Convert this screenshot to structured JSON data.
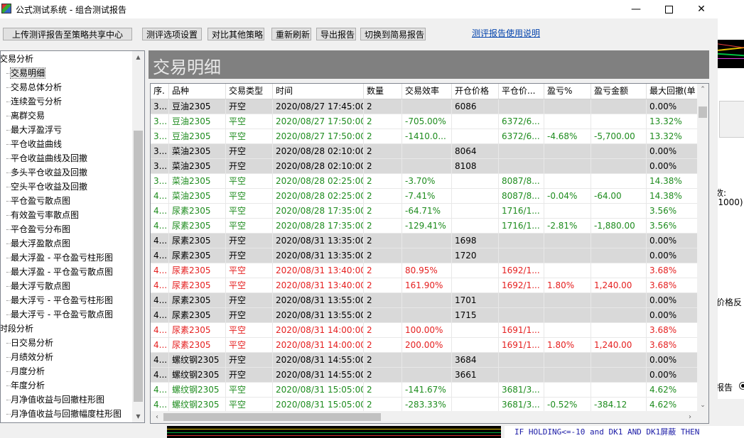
{
  "window": {
    "title": "公式测试系统 - 组合测试报告"
  },
  "toolbar": {
    "upload_label": "上传测评报告至策略共享中心",
    "options_label": "测评选项设置",
    "compare_label": "对比其他策略",
    "refresh_label": "重新刷新",
    "export_label": "导出报告",
    "switch_label": "切换到简易报告",
    "help_link": "测评报告使用说明"
  },
  "tree": {
    "groups": [
      {
        "label": "交易分析",
        "items": [
          "交易明细",
          "交易总体分析",
          "连续盈亏分析",
          "离群交易",
          "最大浮盈浮亏",
          "平仓收益曲线",
          "平仓收益曲线及回撤",
          "多头平仓收益及回撤",
          "空头平仓收益及回撤",
          "平仓盈亏散点图",
          "有效盈亏率散点图",
          "平仓盈亏分布图",
          "最大浮盈散点图",
          "最大浮盈 - 平仓盈亏柱形图",
          "最大浮盈 - 平仓盈亏散点图",
          "最大浮亏散点图",
          "最大浮亏 - 平仓盈亏柱形图",
          "最大浮亏 - 平仓盈亏散点图"
        ]
      },
      {
        "label": "时段分析",
        "items": [
          "日交易分析",
          "月绩效分析",
          "月度分析",
          "年度分析",
          "月净值收益与回撤柱形图",
          "月净值收益与回撤幅度柱形图"
        ]
      }
    ],
    "selected": "交易明细"
  },
  "main": {
    "title": "交易明细",
    "columns": [
      "序.",
      "品种",
      "交易类型",
      "时间",
      "数量",
      "交易效率",
      "开仓价格",
      "平仓价...",
      "盈亏%",
      "盈亏金额",
      "最大回撤(单"
    ],
    "rows": [
      {
        "style": "gray",
        "color": "black",
        "cells": [
          "3...",
          "豆油2305",
          "开空",
          "2020/08/27 17:45:00",
          "2",
          "",
          "6086",
          "",
          "",
          "",
          "0.00%"
        ]
      },
      {
        "style": "white",
        "color": "green",
        "cells": [
          "3...",
          "豆油2305",
          "平空",
          "2020/08/27 17:50:00",
          "2",
          "-705.00%",
          "",
          "6372/6...",
          "",
          "",
          "13.32%"
        ]
      },
      {
        "style": "white",
        "color": "green",
        "cells": [
          "3...",
          "豆油2305",
          "平空",
          "2020/08/27 17:50:00",
          "2",
          "-1410.0...",
          "",
          "6372/6...",
          "-4.68%",
          "-5,700.00",
          "13.32%"
        ]
      },
      {
        "style": "gray",
        "color": "black",
        "cells": [
          "3...",
          "菜油2305",
          "开空",
          "2020/08/28 02:10:00",
          "2",
          "",
          "8064",
          "",
          "",
          "",
          "0.00%"
        ]
      },
      {
        "style": "gray",
        "color": "black",
        "cells": [
          "3...",
          "菜油2305",
          "开空",
          "2020/08/28 02:10:00",
          "2",
          "",
          "8108",
          "",
          "",
          "",
          "0.00%"
        ]
      },
      {
        "style": "white",
        "color": "green",
        "cells": [
          "3...",
          "菜油2305",
          "平空",
          "2020/08/28 02:25:00",
          "2",
          "-3.70%",
          "",
          "8087/8...",
          "",
          "",
          "14.38%"
        ]
      },
      {
        "style": "white",
        "color": "green",
        "cells": [
          "4...",
          "菜油2305",
          "平空",
          "2020/08/28 02:25:00",
          "2",
          "-7.41%",
          "",
          "8087/8...",
          "-0.04%",
          "-64.00",
          "14.38%"
        ]
      },
      {
        "style": "white",
        "color": "green",
        "cells": [
          "4...",
          "尿素2305",
          "平空",
          "2020/08/28 17:35:00",
          "2",
          "-64.71%",
          "",
          "1716/1...",
          "",
          "",
          "3.56%"
        ]
      },
      {
        "style": "white",
        "color": "green",
        "cells": [
          "4...",
          "尿素2305",
          "平空",
          "2020/08/28 17:35:00",
          "2",
          "-129.41%",
          "",
          "1716/1...",
          "-2.81%",
          "-1,880.00",
          "3.56%"
        ]
      },
      {
        "style": "gray",
        "color": "black",
        "cells": [
          "4...",
          "尿素2305",
          "开空",
          "2020/08/31 13:35:00",
          "2",
          "",
          "1698",
          "",
          "",
          "",
          "0.00%"
        ]
      },
      {
        "style": "gray",
        "color": "black",
        "cells": [
          "4...",
          "尿素2305",
          "开空",
          "2020/08/31 13:35:00",
          "2",
          "",
          "1720",
          "",
          "",
          "",
          "0.00%"
        ]
      },
      {
        "style": "white",
        "color": "red",
        "cells": [
          "4...",
          "尿素2305",
          "平空",
          "2020/08/31 13:40:00",
          "2",
          "80.95%",
          "",
          "1692/1...",
          "",
          "",
          "3.68%"
        ]
      },
      {
        "style": "white",
        "color": "red",
        "cells": [
          "4...",
          "尿素2305",
          "平空",
          "2020/08/31 13:40:00",
          "2",
          "161.90%",
          "",
          "1692/1...",
          "1.80%",
          "1,240.00",
          "3.68%"
        ]
      },
      {
        "style": "gray",
        "color": "black",
        "cells": [
          "4...",
          "尿素2305",
          "开空",
          "2020/08/31 13:55:00",
          "2",
          "",
          "1701",
          "",
          "",
          "",
          "0.00%"
        ]
      },
      {
        "style": "gray",
        "color": "black",
        "cells": [
          "4...",
          "尿素2305",
          "开空",
          "2020/08/31 13:55:00",
          "2",
          "",
          "1715",
          "",
          "",
          "",
          "0.00%"
        ]
      },
      {
        "style": "white",
        "color": "red",
        "cells": [
          "4...",
          "尿素2305",
          "平空",
          "2020/08/31 14:00:00",
          "2",
          "100.00%",
          "",
          "1691/1...",
          "",
          "",
          "3.68%"
        ]
      },
      {
        "style": "white",
        "color": "red",
        "cells": [
          "4...",
          "尿素2305",
          "平空",
          "2020/08/31 14:00:00",
          "2",
          "200.00%",
          "",
          "1691/1...",
          "1.80%",
          "1,240.00",
          "3.68%"
        ]
      },
      {
        "style": "gray",
        "color": "black",
        "cells": [
          "4...",
          "螺纹钢2305",
          "开空",
          "2020/08/31 14:55:00",
          "2",
          "",
          "3684",
          "",
          "",
          "",
          "0.00%"
        ]
      },
      {
        "style": "gray",
        "color": "black",
        "cells": [
          "4...",
          "螺纹钢2305",
          "开空",
          "2020/08/31 14:55:00",
          "2",
          "",
          "3661",
          "",
          "",
          "",
          "0.00%"
        ]
      },
      {
        "style": "white",
        "color": "green",
        "cells": [
          "4...",
          "螺纹钢2305",
          "平空",
          "2020/08/31 15:05:00",
          "2",
          "-141.67%",
          "",
          "3681/3...",
          "",
          "",
          "4.62%"
        ]
      },
      {
        "style": "white",
        "color": "green",
        "cells": [
          "4...",
          "螺纹钢2305",
          "平空",
          "2020/08/31 15:05:00",
          "2",
          "-283.33%",
          "",
          "3681/3...",
          "-0.52%",
          "-384.12",
          "4.62%"
        ]
      }
    ]
  },
  "background": {
    "right_text_1": "数:",
    "right_text_2": "-1000)",
    "right_text_3": "价格反",
    "right_text_4": "报告",
    "code_text": "IF HOLDING<=-10 and DK1 AND DK1屏蔽 THEN "
  },
  "colors": {
    "green_text": "#1e8c1e",
    "red_text": "#e52020",
    "gray_row": "#d9d9d9",
    "header_band": "#808080",
    "link": "#0645ad"
  }
}
